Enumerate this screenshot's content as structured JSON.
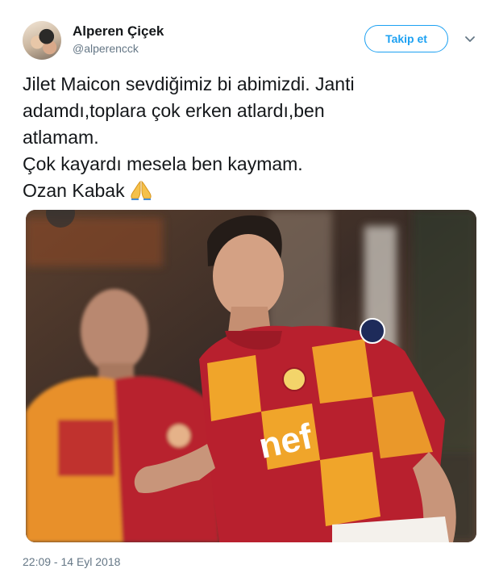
{
  "author": {
    "display_name": "Alperen Çiçek",
    "handle": "@alperencck"
  },
  "follow_button": {
    "label": "Takip et"
  },
  "tweet": {
    "lines": [
      "Jilet Maicon sevdiğimiz bi abimizdi. Janti",
      "adamdı,toplara çok erken atlardı,ben",
      "atlamam.",
      "Çok kayardı mesela ben kaymam.",
      "Ozan Kabak"
    ],
    "emoji": "folded-hands",
    "timestamp": "22:09 - 14 Eyl 2018"
  },
  "media": {
    "shirt_text": "nef",
    "colors": {
      "red": "#b8202e",
      "orange": "#f0a52a",
      "dark": "#2a2320"
    }
  },
  "colors": {
    "accent": "#1da1f2",
    "muted": "#657786"
  }
}
